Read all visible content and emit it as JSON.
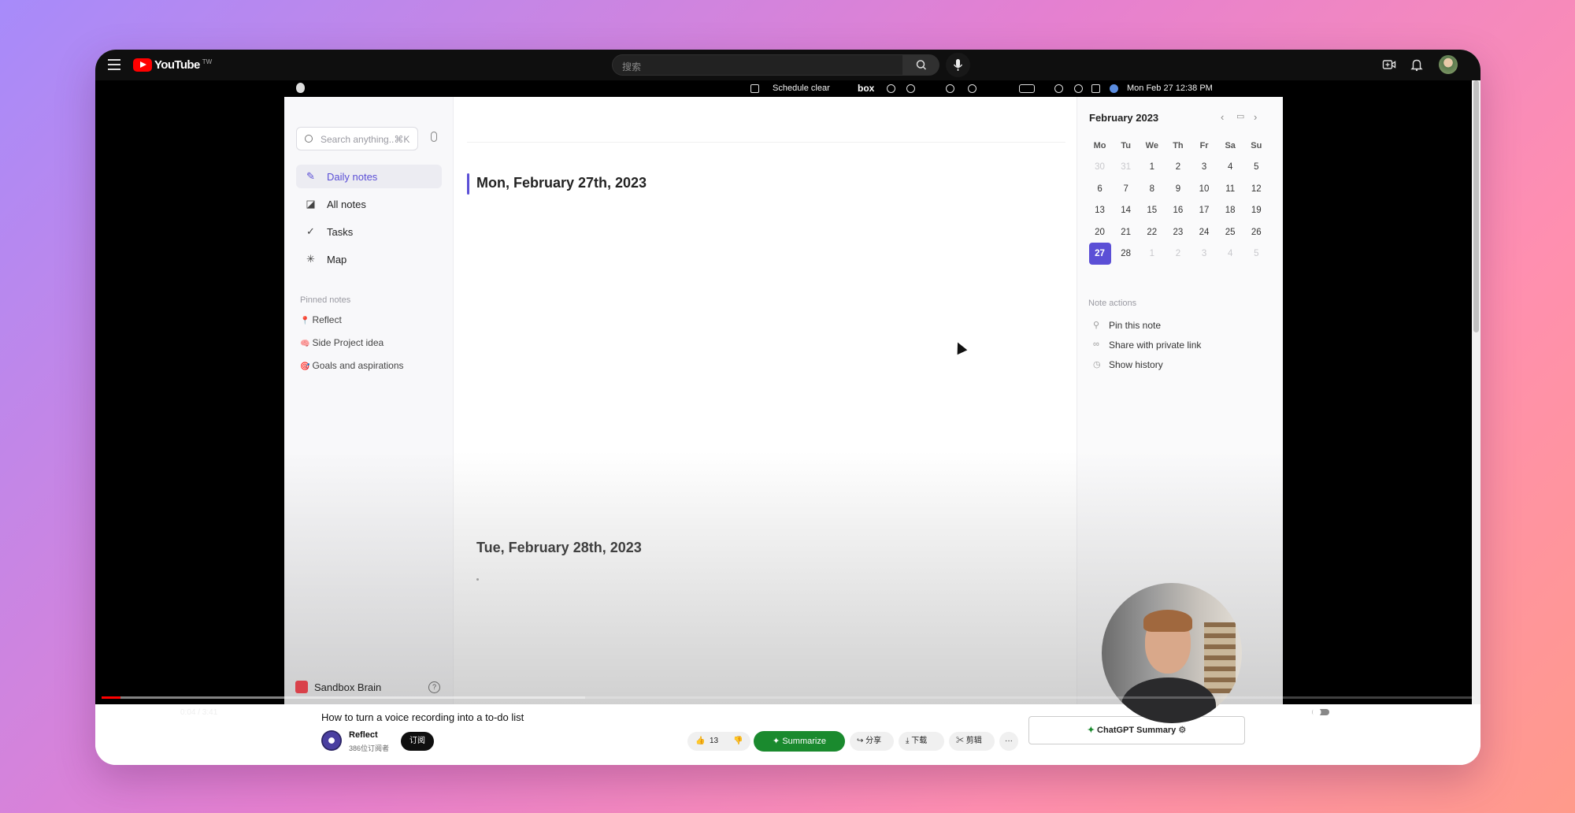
{
  "header": {
    "logo_text": "YouTube",
    "logo_region": "TW",
    "search_placeholder": "搜索"
  },
  "mac_bar": {
    "focus_status": "Schedule clear",
    "box_label": "box",
    "clock": "Mon Feb 27  12:38 PM"
  },
  "sidebar": {
    "search_placeholder": "Search anything..⌘K",
    "nav": [
      {
        "label": "Daily notes",
        "icon": "pencil-icon",
        "active": true
      },
      {
        "label": "All notes",
        "icon": "notes-icon",
        "active": false
      },
      {
        "label": "Tasks",
        "icon": "check-circle-icon",
        "active": false
      },
      {
        "label": "Map",
        "icon": "map-icon",
        "active": false
      }
    ],
    "pinned_heading": "Pinned notes",
    "pinned": [
      {
        "emoji": "📍",
        "label": "Reflect"
      },
      {
        "emoji": "🧠",
        "label": "Side Project idea"
      },
      {
        "emoji": "🎯",
        "label": "Goals and aspirations"
      }
    ],
    "workspace": "Sandbox Brain",
    "help": "?"
  },
  "main": {
    "date1": "Mon, February 27th, 2023",
    "date2": "Tue, February 28th, 2023"
  },
  "calendar": {
    "month": "February 2023",
    "weekdays": [
      "Mo",
      "Tu",
      "We",
      "Th",
      "Fr",
      "Sa",
      "Su"
    ],
    "weeks": [
      [
        {
          "d": "30",
          "m": true
        },
        {
          "d": "31",
          "m": true
        },
        {
          "d": "1"
        },
        {
          "d": "2"
        },
        {
          "d": "3"
        },
        {
          "d": "4"
        },
        {
          "d": "5"
        }
      ],
      [
        {
          "d": "6"
        },
        {
          "d": "7"
        },
        {
          "d": "8"
        },
        {
          "d": "9"
        },
        {
          "d": "10"
        },
        {
          "d": "11"
        },
        {
          "d": "12"
        }
      ],
      [
        {
          "d": "13"
        },
        {
          "d": "14"
        },
        {
          "d": "15"
        },
        {
          "d": "16"
        },
        {
          "d": "17"
        },
        {
          "d": "18"
        },
        {
          "d": "19"
        }
      ],
      [
        {
          "d": "20"
        },
        {
          "d": "21"
        },
        {
          "d": "22"
        },
        {
          "d": "23"
        },
        {
          "d": "24"
        },
        {
          "d": "25"
        },
        {
          "d": "26"
        }
      ],
      [
        {
          "d": "27",
          "sel": true
        },
        {
          "d": "28"
        },
        {
          "d": "1",
          "m": true
        },
        {
          "d": "2",
          "m": true
        },
        {
          "d": "3",
          "m": true
        },
        {
          "d": "4",
          "m": true
        },
        {
          "d": "5",
          "m": true
        }
      ]
    ],
    "accent": "#5b4fd6"
  },
  "note_actions": {
    "heading": "Note actions",
    "items": [
      {
        "label": "Pin this note",
        "icon": "pin-icon"
      },
      {
        "label": "Share with private link",
        "icon": "link-icon"
      },
      {
        "label": "Show history",
        "icon": "clock-icon"
      }
    ]
  },
  "player": {
    "time": "0:04 / 3:41",
    "progress_played": 0.014,
    "progress_buffered": 0.352
  },
  "video_info": {
    "title": "How to turn a voice recording into a to-do list",
    "channel": "Reflect",
    "subscribers": "386位订阅者",
    "subscribe_label": "订阅",
    "likes": "13",
    "summarize_label": "Summarize",
    "share_label": "分享",
    "download_label": "下载",
    "clip_label": "剪辑",
    "more_label": "···",
    "chatgpt_label": "ChatGPT Summary"
  }
}
